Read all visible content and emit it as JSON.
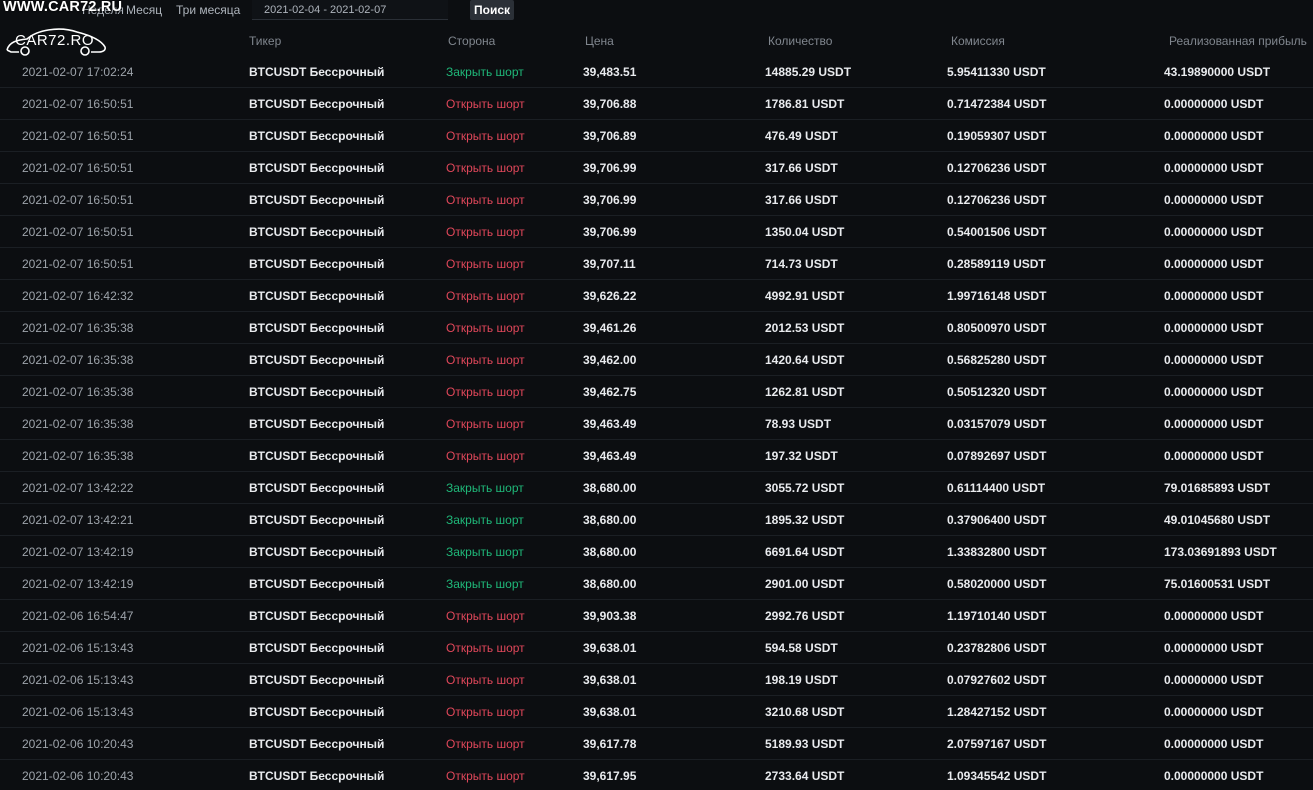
{
  "watermark": {
    "site": "WWW.CAR72.RU",
    "logo_text": "CAR72.RO"
  },
  "filters": {
    "week": "Неделя",
    "month": "Месяц",
    "three_months": "Три месяца",
    "date_range": "2021-02-04 - 2021-02-07",
    "search_label": "Поиск"
  },
  "table": {
    "headers": {
      "ticker": "Тикер",
      "side": "Сторона",
      "price": "Цена",
      "qty": "Количество",
      "fee": "Комиссия",
      "pnl": "Реализованная прибыль"
    },
    "rows": [
      {
        "time": "2021-02-07 17:02:24",
        "ticker": "BTCUSDT Бессрочный",
        "side": "Закрыть шорт",
        "side_type": "close",
        "price": "39,483.51",
        "qty": "14885.29 USDT",
        "fee": "5.95411330 USDT",
        "pnl": "43.19890000 USDT"
      },
      {
        "time": "2021-02-07 16:50:51",
        "ticker": "BTCUSDT Бессрочный",
        "side": "Открыть шорт",
        "side_type": "open",
        "price": "39,706.88",
        "qty": "1786.81 USDT",
        "fee": "0.71472384 USDT",
        "pnl": "0.00000000 USDT"
      },
      {
        "time": "2021-02-07 16:50:51",
        "ticker": "BTCUSDT Бессрочный",
        "side": "Открыть шорт",
        "side_type": "open",
        "price": "39,706.89",
        "qty": "476.49 USDT",
        "fee": "0.19059307 USDT",
        "pnl": "0.00000000 USDT"
      },
      {
        "time": "2021-02-07 16:50:51",
        "ticker": "BTCUSDT Бессрочный",
        "side": "Открыть шорт",
        "side_type": "open",
        "price": "39,706.99",
        "qty": "317.66 USDT",
        "fee": "0.12706236 USDT",
        "pnl": "0.00000000 USDT"
      },
      {
        "time": "2021-02-07 16:50:51",
        "ticker": "BTCUSDT Бессрочный",
        "side": "Открыть шорт",
        "side_type": "open",
        "price": "39,706.99",
        "qty": "317.66 USDT",
        "fee": "0.12706236 USDT",
        "pnl": "0.00000000 USDT"
      },
      {
        "time": "2021-02-07 16:50:51",
        "ticker": "BTCUSDT Бессрочный",
        "side": "Открыть шорт",
        "side_type": "open",
        "price": "39,706.99",
        "qty": "1350.04 USDT",
        "fee": "0.54001506 USDT",
        "pnl": "0.00000000 USDT"
      },
      {
        "time": "2021-02-07 16:50:51",
        "ticker": "BTCUSDT Бессрочный",
        "side": "Открыть шорт",
        "side_type": "open",
        "price": "39,707.11",
        "qty": "714.73 USDT",
        "fee": "0.28589119 USDT",
        "pnl": "0.00000000 USDT"
      },
      {
        "time": "2021-02-07 16:42:32",
        "ticker": "BTCUSDT Бессрочный",
        "side": "Открыть шорт",
        "side_type": "open",
        "price": "39,626.22",
        "qty": "4992.91 USDT",
        "fee": "1.99716148 USDT",
        "pnl": "0.00000000 USDT"
      },
      {
        "time": "2021-02-07 16:35:38",
        "ticker": "BTCUSDT Бессрочный",
        "side": "Открыть шорт",
        "side_type": "open",
        "price": "39,461.26",
        "qty": "2012.53 USDT",
        "fee": "0.80500970 USDT",
        "pnl": "0.00000000 USDT"
      },
      {
        "time": "2021-02-07 16:35:38",
        "ticker": "BTCUSDT Бессрочный",
        "side": "Открыть шорт",
        "side_type": "open",
        "price": "39,462.00",
        "qty": "1420.64 USDT",
        "fee": "0.56825280 USDT",
        "pnl": "0.00000000 USDT"
      },
      {
        "time": "2021-02-07 16:35:38",
        "ticker": "BTCUSDT Бессрочный",
        "side": "Открыть шорт",
        "side_type": "open",
        "price": "39,462.75",
        "qty": "1262.81 USDT",
        "fee": "0.50512320 USDT",
        "pnl": "0.00000000 USDT"
      },
      {
        "time": "2021-02-07 16:35:38",
        "ticker": "BTCUSDT Бессрочный",
        "side": "Открыть шорт",
        "side_type": "open",
        "price": "39,463.49",
        "qty": "78.93 USDT",
        "fee": "0.03157079 USDT",
        "pnl": "0.00000000 USDT"
      },
      {
        "time": "2021-02-07 16:35:38",
        "ticker": "BTCUSDT Бессрочный",
        "side": "Открыть шорт",
        "side_type": "open",
        "price": "39,463.49",
        "qty": "197.32 USDT",
        "fee": "0.07892697 USDT",
        "pnl": "0.00000000 USDT"
      },
      {
        "time": "2021-02-07 13:42:22",
        "ticker": "BTCUSDT Бессрочный",
        "side": "Закрыть шорт",
        "side_type": "close",
        "price": "38,680.00",
        "qty": "3055.72 USDT",
        "fee": "0.61114400 USDT",
        "pnl": "79.01685893 USDT"
      },
      {
        "time": "2021-02-07 13:42:21",
        "ticker": "BTCUSDT Бессрочный",
        "side": "Закрыть шорт",
        "side_type": "close",
        "price": "38,680.00",
        "qty": "1895.32 USDT",
        "fee": "0.37906400 USDT",
        "pnl": "49.01045680 USDT"
      },
      {
        "time": "2021-02-07 13:42:19",
        "ticker": "BTCUSDT Бессрочный",
        "side": "Закрыть шорт",
        "side_type": "close",
        "price": "38,680.00",
        "qty": "6691.64 USDT",
        "fee": "1.33832800 USDT",
        "pnl": "173.03691893 USDT"
      },
      {
        "time": "2021-02-07 13:42:19",
        "ticker": "BTCUSDT Бессрочный",
        "side": "Закрыть шорт",
        "side_type": "close",
        "price": "38,680.00",
        "qty": "2901.00 USDT",
        "fee": "0.58020000 USDT",
        "pnl": "75.01600531 USDT"
      },
      {
        "time": "2021-02-06 16:54:47",
        "ticker": "BTCUSDT Бессрочный",
        "side": "Открыть шорт",
        "side_type": "open",
        "price": "39,903.38",
        "qty": "2992.76 USDT",
        "fee": "1.19710140 USDT",
        "pnl": "0.00000000 USDT"
      },
      {
        "time": "2021-02-06 15:13:43",
        "ticker": "BTCUSDT Бессрочный",
        "side": "Открыть шорт",
        "side_type": "open",
        "price": "39,638.01",
        "qty": "594.58 USDT",
        "fee": "0.23782806 USDT",
        "pnl": "0.00000000 USDT"
      },
      {
        "time": "2021-02-06 15:13:43",
        "ticker": "BTCUSDT Бессрочный",
        "side": "Открыть шорт",
        "side_type": "open",
        "price": "39,638.01",
        "qty": "198.19 USDT",
        "fee": "0.07927602 USDT",
        "pnl": "0.00000000 USDT"
      },
      {
        "time": "2021-02-06 15:13:43",
        "ticker": "BTCUSDT Бессрочный",
        "side": "Открыть шорт",
        "side_type": "open",
        "price": "39,638.01",
        "qty": "3210.68 USDT",
        "fee": "1.28427152 USDT",
        "pnl": "0.00000000 USDT"
      },
      {
        "time": "2021-02-06 10:20:43",
        "ticker": "BTCUSDT Бессрочный",
        "side": "Открыть шорт",
        "side_type": "open",
        "price": "39,617.78",
        "qty": "5189.93 USDT",
        "fee": "2.07597167 USDT",
        "pnl": "0.00000000 USDT"
      },
      {
        "time": "2021-02-06 10:20:43",
        "ticker": "BTCUSDT Бессрочный",
        "side": "Открыть шорт",
        "side_type": "open",
        "price": "39,617.95",
        "qty": "2733.64 USDT",
        "fee": "1.09345542 USDT",
        "pnl": "0.00000000 USDT"
      }
    ]
  },
  "colors": {
    "background": "#0c0e11",
    "close_short": "#1fb879",
    "open_short": "#e0475a"
  }
}
